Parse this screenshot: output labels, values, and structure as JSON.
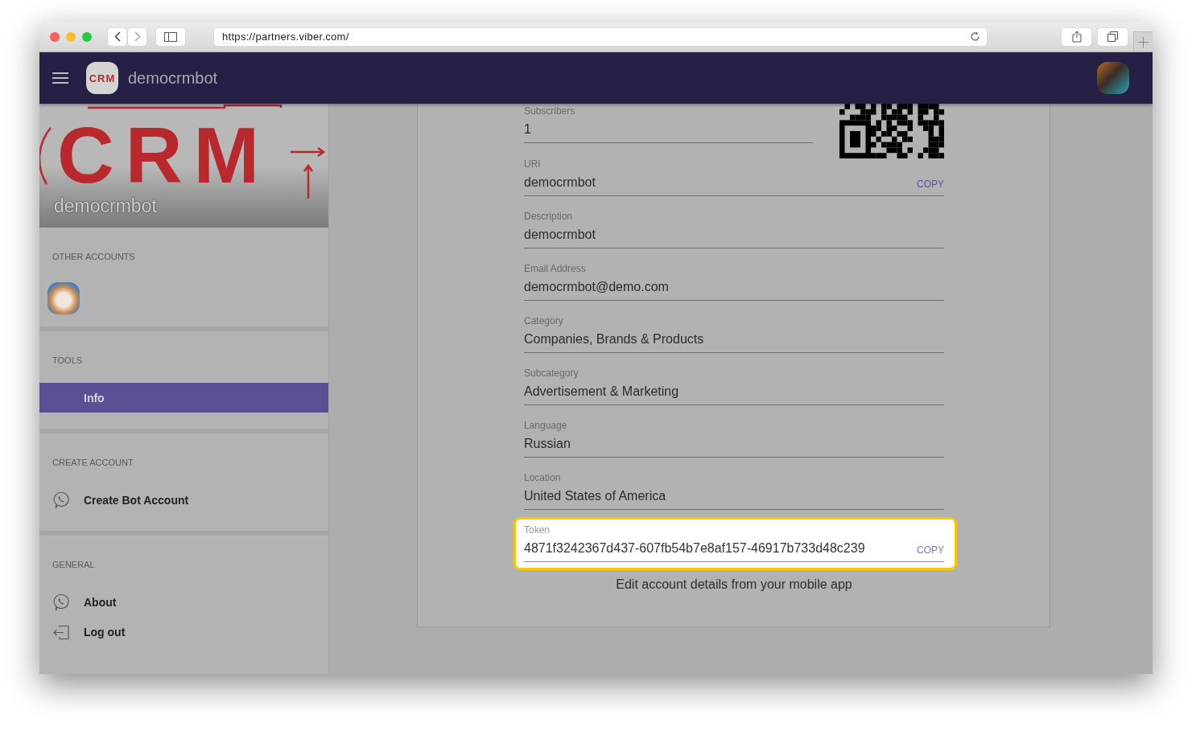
{
  "browser": {
    "url": "https://partners.viber.com/"
  },
  "header": {
    "logo_text": "CRM",
    "title": "democrmbot"
  },
  "sidebar": {
    "banner": {
      "logo_text": "CRM",
      "name": "democrmbot"
    },
    "sections": [
      {
        "title": "OTHER ACCOUNTS",
        "kind": "avatars",
        "items": [
          {
            "kind": "avatar"
          }
        ]
      },
      {
        "title": "TOOLS",
        "kind": "menu",
        "items": [
          {
            "label": "Info",
            "selected": true
          }
        ]
      },
      {
        "title": "CREATE ACCOUNT",
        "kind": "menu",
        "items": [
          {
            "label": "Create Bot Account",
            "kind": "chat",
            "selected": false
          }
        ]
      },
      {
        "title": "GENERAL",
        "kind": "menu",
        "items": [
          {
            "label": "About",
            "kind": "chat",
            "selected": false
          },
          {
            "label": "Log out",
            "kind": "exit",
            "selected": false
          }
        ]
      }
    ]
  },
  "details": {
    "qr_code": true,
    "fields": [
      {
        "label": "Subscribers",
        "value": "1"
      },
      {
        "label": "URI",
        "value": "democrmbot",
        "action": "COPY"
      },
      {
        "label": "Description",
        "value": "democrmbot"
      },
      {
        "label": "Email Address",
        "value": "democrmbot@demo.com"
      },
      {
        "label": "Category",
        "value": "Companies, Brands & Products"
      },
      {
        "label": "Subcategory",
        "value": "Advertisement & Marketing"
      },
      {
        "label": "Language",
        "value": "Russian"
      },
      {
        "label": "Location",
        "value": "United States of America"
      },
      {
        "label": "Token",
        "value": "4871f3242367d437-607fb54b7e8af157-46917b733d48c239",
        "action": "COPY",
        "highlighted": true
      }
    ],
    "note": "Edit account details from your mobile app"
  }
}
